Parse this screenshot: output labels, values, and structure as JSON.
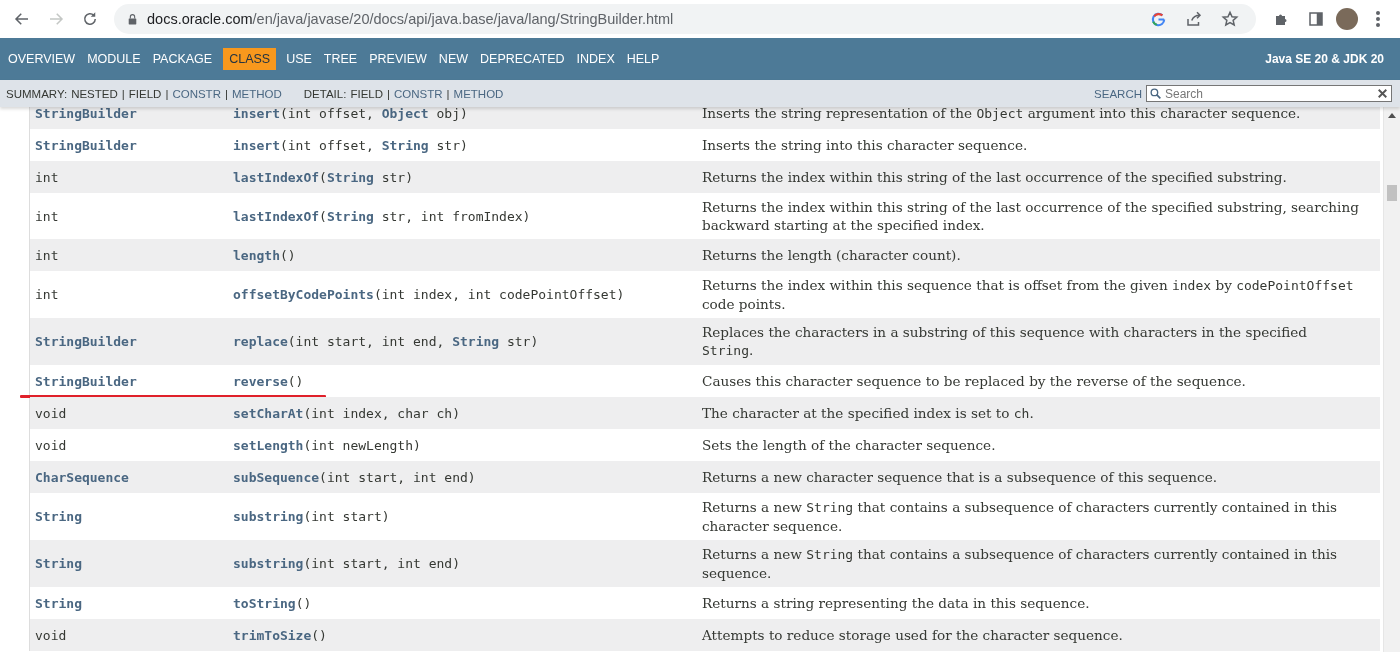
{
  "browser": {
    "url_host": "docs.oracle.com",
    "url_path": "/en/java/javase/20/docs/api/java.base/java/lang/StringBuilder.html",
    "forward_disabled": true
  },
  "nav": {
    "items": [
      {
        "label": "OVERVIEW",
        "selected": false
      },
      {
        "label": "MODULE",
        "selected": false
      },
      {
        "label": "PACKAGE",
        "selected": false
      },
      {
        "label": "CLASS",
        "selected": true
      },
      {
        "label": "USE",
        "selected": false
      },
      {
        "label": "TREE",
        "selected": false
      },
      {
        "label": "PREVIEW",
        "selected": false
      },
      {
        "label": "NEW",
        "selected": false
      },
      {
        "label": "DEPRECATED",
        "selected": false
      },
      {
        "label": "INDEX",
        "selected": false
      },
      {
        "label": "HELP",
        "selected": false
      }
    ],
    "title": "Java SE 20 & JDK 20"
  },
  "subnav": {
    "separator": "|",
    "groups": [
      {
        "label": "SUMMARY:",
        "items": [
          {
            "label": "NESTED",
            "link": false
          },
          {
            "label": "FIELD",
            "link": false
          },
          {
            "label": "CONSTR",
            "link": true
          },
          {
            "label": "METHOD",
            "link": true
          }
        ]
      },
      {
        "label": "DETAIL:",
        "items": [
          {
            "label": "FIELD",
            "link": false
          },
          {
            "label": "CONSTR",
            "link": true
          },
          {
            "label": "METHOD",
            "link": true
          }
        ]
      }
    ],
    "search_label": "SEARCH",
    "search_placeholder": "Search"
  },
  "table": {
    "rows": [
      {
        "type": {
          "text": "StringBuilder",
          "link": true
        },
        "method": [
          {
            "t": "insert",
            "link": true
          },
          {
            "t": "(int offset, ",
            "link": false
          },
          {
            "t": "Object",
            "link": true
          },
          {
            "t": " obj)",
            "link": false
          }
        ],
        "description": [
          {
            "t": "Inserts the string representation of the ",
            "code": false
          },
          {
            "t": "Object",
            "code": true
          },
          {
            "t": " argument into this character sequence.",
            "code": false
          }
        ],
        "underlined": false
      },
      {
        "type": {
          "text": "StringBuilder",
          "link": true
        },
        "method": [
          {
            "t": "insert",
            "link": true
          },
          {
            "t": "(int offset, ",
            "link": false
          },
          {
            "t": "String",
            "link": true
          },
          {
            "t": " str)",
            "link": false
          }
        ],
        "description": [
          {
            "t": "Inserts the string into this character sequence.",
            "code": false
          }
        ],
        "underlined": false
      },
      {
        "type": {
          "text": "int",
          "link": false
        },
        "method": [
          {
            "t": "lastIndexOf",
            "link": true
          },
          {
            "t": "(",
            "link": false
          },
          {
            "t": "String",
            "link": true
          },
          {
            "t": " str)",
            "link": false
          }
        ],
        "description": [
          {
            "t": "Returns the index within this string of the last occurrence of the specified substring.",
            "code": false
          }
        ],
        "underlined": false
      },
      {
        "type": {
          "text": "int",
          "link": false
        },
        "method": [
          {
            "t": "lastIndexOf",
            "link": true
          },
          {
            "t": "(",
            "link": false
          },
          {
            "t": "String",
            "link": true
          },
          {
            "t": " str, int fromIndex)",
            "link": false
          }
        ],
        "description": [
          {
            "t": "Returns the index within this string of the last occurrence of the specified substring, searching backward starting at the specified index.",
            "code": false
          }
        ],
        "underlined": false
      },
      {
        "type": {
          "text": "int",
          "link": false
        },
        "method": [
          {
            "t": "length",
            "link": true
          },
          {
            "t": "()",
            "link": false
          }
        ],
        "description": [
          {
            "t": "Returns the length (character count).",
            "code": false
          }
        ],
        "underlined": false
      },
      {
        "type": {
          "text": "int",
          "link": false
        },
        "method": [
          {
            "t": "offsetByCodePoints",
            "link": true
          },
          {
            "t": "(int index, int codePointOffset)",
            "link": false
          }
        ],
        "description": [
          {
            "t": "Returns the index within this sequence that is offset from the given ",
            "code": false
          },
          {
            "t": "index",
            "code": true
          },
          {
            "t": " by ",
            "code": false
          },
          {
            "t": "codePointOffset",
            "code": true
          },
          {
            "t": " code points.",
            "code": false
          }
        ],
        "underlined": false
      },
      {
        "type": {
          "text": "StringBuilder",
          "link": true
        },
        "method": [
          {
            "t": "replace",
            "link": true
          },
          {
            "t": "(int start, int end, ",
            "link": false
          },
          {
            "t": "String",
            "link": true
          },
          {
            "t": " str)",
            "link": false
          }
        ],
        "description": [
          {
            "t": "Replaces the characters in a substring of this sequence with characters in the specified ",
            "code": false
          },
          {
            "t": "String",
            "code": true
          },
          {
            "t": ".",
            "code": false
          }
        ],
        "underlined": false
      },
      {
        "type": {
          "text": "StringBuilder",
          "link": true
        },
        "method": [
          {
            "t": "reverse",
            "link": true
          },
          {
            "t": "()",
            "link": false
          }
        ],
        "description": [
          {
            "t": "Causes this character sequence to be replaced by the reverse of the sequence.",
            "code": false
          }
        ],
        "underlined": true
      },
      {
        "type": {
          "text": "void",
          "link": false
        },
        "method": [
          {
            "t": "setCharAt",
            "link": true
          },
          {
            "t": "(int index, char ch)",
            "link": false
          }
        ],
        "description": [
          {
            "t": "The character at the specified index is set to ",
            "code": false
          },
          {
            "t": "ch",
            "code": true
          },
          {
            "t": ".",
            "code": false
          }
        ],
        "underlined": false
      },
      {
        "type": {
          "text": "void",
          "link": false
        },
        "method": [
          {
            "t": "setLength",
            "link": true
          },
          {
            "t": "(int newLength)",
            "link": false
          }
        ],
        "description": [
          {
            "t": "Sets the length of the character sequence.",
            "code": false
          }
        ],
        "underlined": false
      },
      {
        "type": {
          "text": "CharSequence",
          "link": true
        },
        "method": [
          {
            "t": "subSequence",
            "link": true
          },
          {
            "t": "(int start, int end)",
            "link": false
          }
        ],
        "description": [
          {
            "t": "Returns a new character sequence that is a subsequence of this sequence.",
            "code": false
          }
        ],
        "underlined": false
      },
      {
        "type": {
          "text": "String",
          "link": true
        },
        "method": [
          {
            "t": "substring",
            "link": true
          },
          {
            "t": "(int start)",
            "link": false
          }
        ],
        "description": [
          {
            "t": "Returns a new ",
            "code": false
          },
          {
            "t": "String",
            "code": true
          },
          {
            "t": " that contains a subsequence of characters currently contained in this character sequence.",
            "code": false
          }
        ],
        "underlined": false
      },
      {
        "type": {
          "text": "String",
          "link": true
        },
        "method": [
          {
            "t": "substring",
            "link": true
          },
          {
            "t": "(int start, int end)",
            "link": false
          }
        ],
        "description": [
          {
            "t": "Returns a new ",
            "code": false
          },
          {
            "t": "String",
            "code": true
          },
          {
            "t": " that contains a subsequence of characters currently contained in this sequence.",
            "code": false
          }
        ],
        "underlined": false
      },
      {
        "type": {
          "text": "String",
          "link": true
        },
        "method": [
          {
            "t": "toString",
            "link": true
          },
          {
            "t": "()",
            "link": false
          }
        ],
        "description": [
          {
            "t": "Returns a string representing the data in this sequence.",
            "code": false
          }
        ],
        "underlined": false
      },
      {
        "type": {
          "text": "void",
          "link": false
        },
        "method": [
          {
            "t": "trimToSize",
            "link": true
          },
          {
            "t": "()",
            "link": false
          }
        ],
        "description": [
          {
            "t": "Attempts to reduce storage used for the character sequence.",
            "code": false
          }
        ],
        "underlined": false
      }
    ]
  }
}
